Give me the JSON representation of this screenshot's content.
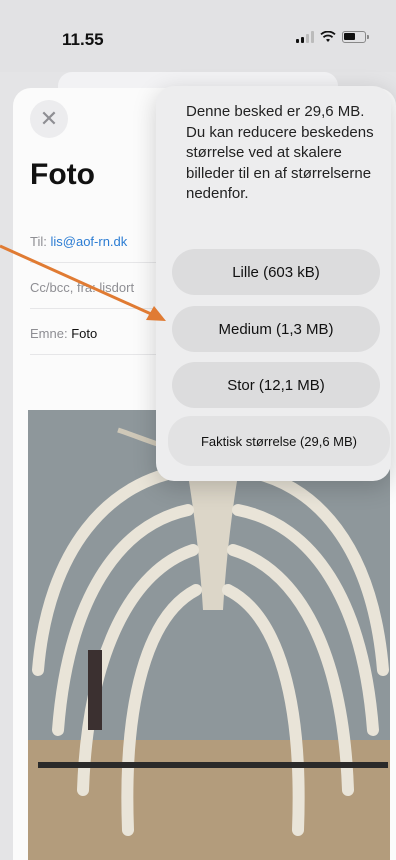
{
  "status": {
    "time": "11.55"
  },
  "compose": {
    "title": "Foto",
    "to_label": "Til:",
    "to_value": "lis@aof-rn.dk",
    "ccbcc_label": "Cc/bcc, fra:",
    "ccbcc_value": "lisdort",
    "subject_label": "Emne:",
    "subject_value": "Foto"
  },
  "popover": {
    "message": "Denne besked er 29,6 MB. Du kan reducere beskedens størrelse ved at skalere billeder til en af størrelserne nedenfor.",
    "options": [
      {
        "label": "Lille (603 kB)"
      },
      {
        "label": "Medium (1,3 MB)"
      },
      {
        "label": "Stor (12,1 MB)"
      },
      {
        "label": "Faktisk størrelse (29,6 MB)"
      }
    ]
  },
  "colors": {
    "accent_link": "#2b7cd3",
    "annotation_arrow": "#e07b33"
  }
}
